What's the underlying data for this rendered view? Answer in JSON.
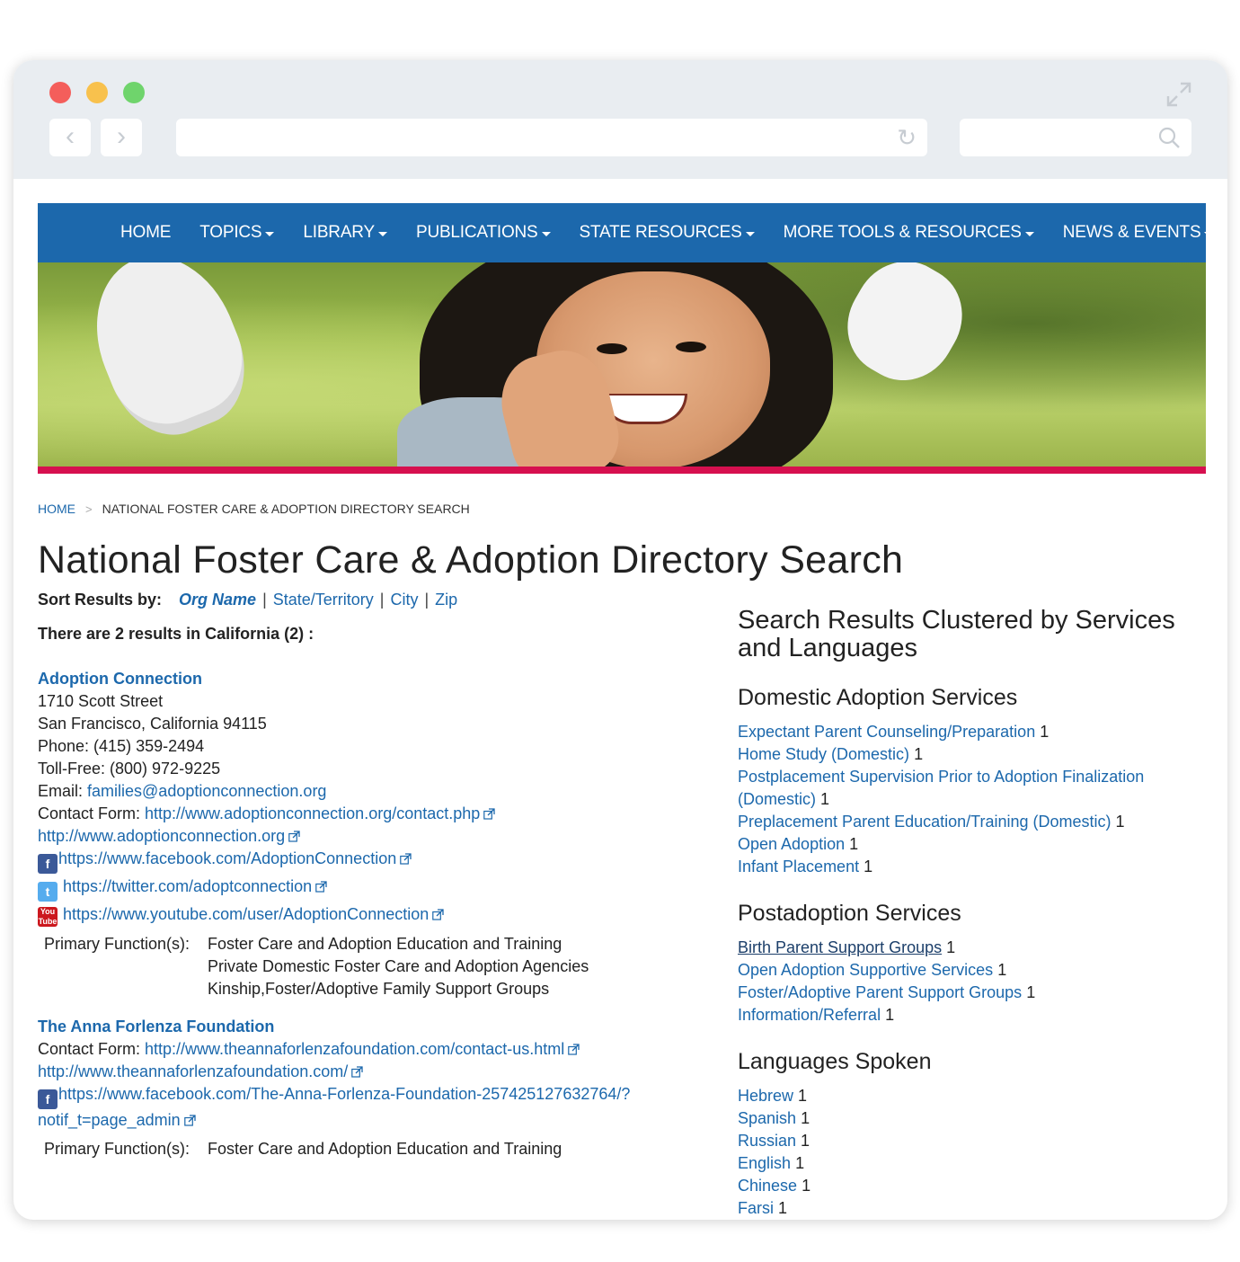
{
  "nav": {
    "items": [
      {
        "label": "HOME",
        "dropdown": false
      },
      {
        "label": "TOPICS",
        "dropdown": true
      },
      {
        "label": "LIBRARY",
        "dropdown": true
      },
      {
        "label": "PUBLICATIONS",
        "dropdown": true
      },
      {
        "label": "STATE RESOURCES",
        "dropdown": true
      },
      {
        "label": "MORE TOOLS & RESOURCES",
        "dropdown": true
      },
      {
        "label": "NEWS & EVENTS",
        "dropdown": true
      }
    ]
  },
  "breadcrumb": {
    "home": "HOME",
    "separator": ">",
    "current": "NATIONAL FOSTER CARE & ADOPTION DIRECTORY SEARCH"
  },
  "page_title": "National Foster Care & Adoption Directory Search",
  "sort": {
    "label": "Sort Results by:",
    "options": [
      "Org Name",
      "State/Territory",
      "City",
      "Zip"
    ],
    "active": "Org Name"
  },
  "result_count": "There are 2 results in California (2) :",
  "orgs": [
    {
      "name": "Adoption Connection",
      "address1": "1710 Scott Street",
      "address2": "San Francisco, California 94115",
      "phone": "Phone: (415) 359-2494",
      "tollfree": "Toll-Free: (800) 972-9225",
      "email_label": "Email: ",
      "email": "families@adoptionconnection.org",
      "contact_label": "Contact Form: ",
      "contact_url": "http://www.adoptionconnection.org/contact.php",
      "website": "http://www.adoptionconnection.org",
      "facebook": "https://www.facebook.com/AdoptionConnection",
      "twitter": "https://twitter.com/adoptconnection",
      "youtube": "https://www.youtube.com/user/AdoptionConnection",
      "functions_label": "Primary Function(s):",
      "functions": [
        "Foster Care and Adoption Education and Training",
        "Private Domestic Foster Care and Adoption Agencies",
        "Kinship,Foster/Adoptive Family Support Groups"
      ]
    },
    {
      "name": "The Anna Forlenza Foundation",
      "contact_label": "Contact Form: ",
      "contact_url": "http://www.theannaforlenzafoundation.com/contact-us.html",
      "website": "http://www.theannaforlenzafoundation.com/",
      "facebook_line1": "https://www.facebook.com/The-Anna-Forlenza-Foundation-257425127632764/?",
      "facebook_line2": "notif_t=page_admin",
      "functions_label": "Primary Function(s):",
      "functions": [
        "Foster Care and Adoption Education and Training"
      ]
    }
  ],
  "clusters": {
    "heading": "Search Results Clustered by Services and Languages",
    "groups": [
      {
        "title": "Domestic Adoption Services",
        "items": [
          {
            "label": "Expectant Parent Counseling/Preparation",
            "count": "1"
          },
          {
            "label": "Home Study (Domestic)",
            "count": "1"
          },
          {
            "label": "Postplacement Supervision Prior to Adoption Finalization (Domestic)",
            "count": "1"
          },
          {
            "label": "Preplacement Parent Education/Training (Domestic)",
            "count": "1"
          },
          {
            "label": "Open Adoption",
            "count": "1"
          },
          {
            "label": "Infant Placement",
            "count": "1"
          }
        ]
      },
      {
        "title": "Postadoption Services",
        "items": [
          {
            "label": "Birth Parent Support Groups",
            "count": "1"
          },
          {
            "label": "Open Adoption Supportive Services",
            "count": "1"
          },
          {
            "label": "Foster/Adoptive Parent Support Groups",
            "count": "1"
          },
          {
            "label": "Information/Referral",
            "count": "1"
          }
        ]
      },
      {
        "title": "Languages Spoken",
        "items": [
          {
            "label": "Hebrew",
            "count": "1"
          },
          {
            "label": "Spanish",
            "count": "1"
          },
          {
            "label": "Russian",
            "count": "1"
          },
          {
            "label": "English",
            "count": "1"
          },
          {
            "label": "Chinese",
            "count": "1"
          },
          {
            "label": "Farsi",
            "count": "1"
          }
        ]
      }
    ]
  },
  "colors": {
    "nav_bg": "#1c68ac",
    "accent_bar": "#d6104f",
    "link": "#1c68ac"
  },
  "icons": {
    "back": "chevron-left-icon",
    "forward": "chevron-right-icon",
    "reload": "reload-icon",
    "search": "search-icon",
    "expand": "expand-icon",
    "external": "external-link-icon"
  }
}
